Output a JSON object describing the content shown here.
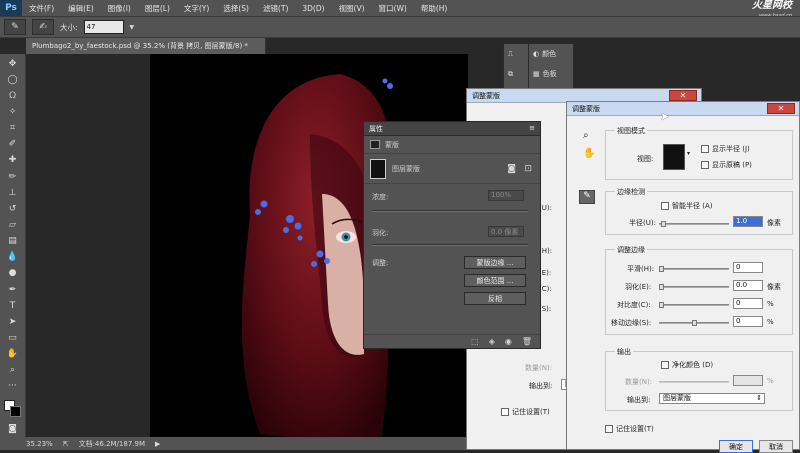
{
  "menubar": {
    "logo": "Ps",
    "items": [
      "文件(F)",
      "编辑(E)",
      "图像(I)",
      "图层(L)",
      "文字(Y)",
      "选择(S)",
      "滤镜(T)",
      "3D(D)",
      "视图(V)",
      "窗口(W)",
      "帮助(H)"
    ]
  },
  "watermark": {
    "brand": "火星网校",
    "url": "www.hxsd.cn"
  },
  "options": {
    "size_label": "大小:",
    "size_value": "47"
  },
  "document": {
    "tab": "Plumbago2_by_faestock.psd @ 35.2% (背景 拷贝, 图层蒙版/8) *"
  },
  "status": {
    "zoom": "35.23%",
    "doc": "文档:46.2M/187.9M"
  },
  "docked_panels": {
    "color": "颜色",
    "swatches": "色板",
    "library": "库",
    "adjust": "调整",
    "styles": "样式"
  },
  "properties": {
    "title": "属性",
    "section": "蒙版",
    "layer_mask": "图层蒙版",
    "density_label": "浓度:",
    "density_value": "100%",
    "feather_label": "羽化:",
    "feather_value": "0.0 像素",
    "adjust_label": "调整:",
    "buttons": [
      "蒙版边缘 ...",
      "颜色范围 ...",
      "反相"
    ]
  },
  "bg_dialog": {
    "title": "调整蒙版",
    "amount_label": "数量(N):",
    "output_label": "输出到:",
    "output_value": "图",
    "remember": "记住设置(T)",
    "partial_1": "(U):",
    "partial_2": "(H):",
    "partial_3": "(E):",
    "partial_4": "(C):",
    "partial_5": "(S):"
  },
  "main_dialog": {
    "title": "调整蒙版",
    "view_mode": "视图模式",
    "view_label": "视图:",
    "show_radius": "显示半径 (J)",
    "show_original": "显示原稿 (P)",
    "edge_detection": "边缘检测",
    "smart_radius": "智能半径 (A)",
    "radius_label": "半径(U):",
    "radius_value": "1.0",
    "radius_unit": "像素",
    "adjust_edge": "调整边缘",
    "smooth_label": "平滑(H):",
    "smooth_value": "0",
    "feather_label": "羽化(E):",
    "feather_value": "0.0",
    "feather_unit": "像素",
    "contrast_label": "对比度(C):",
    "contrast_value": "0",
    "contrast_unit": "%",
    "shift_label": "移动边缘(S):",
    "shift_value": "0",
    "shift_unit": "%",
    "output": "输出",
    "decontaminate": "净化颜色 (D)",
    "amount_label": "数量(N):",
    "amount_unit": "%",
    "output_to_label": "输出到:",
    "output_to_value": "图层蒙版",
    "remember": "记住设置(T)",
    "ok": "确定",
    "cancel": "取消"
  }
}
